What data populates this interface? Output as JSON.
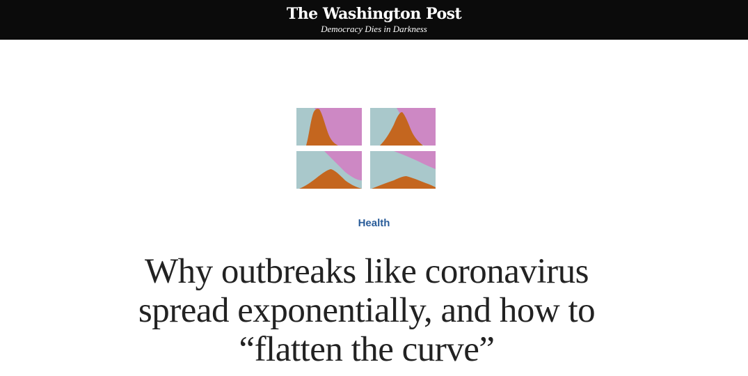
{
  "masthead": {
    "logo_text": "The Washington Post",
    "tagline": "Democracy Dies in Darkness"
  },
  "hero": {
    "icon": "flatten-the-curve-illustration",
    "colors": {
      "susceptible": "#a9c8cb",
      "infected": "#c4661f",
      "recovered": "#cd88c4"
    }
  },
  "article": {
    "section": "Health",
    "headline": "Why outbreaks like coronavirus spread exponentially, and how to “flatten the curve”"
  },
  "colors": {
    "masthead_bg": "#0b0b0b",
    "section_link": "#2a5d9a",
    "headline_text": "#222222"
  }
}
